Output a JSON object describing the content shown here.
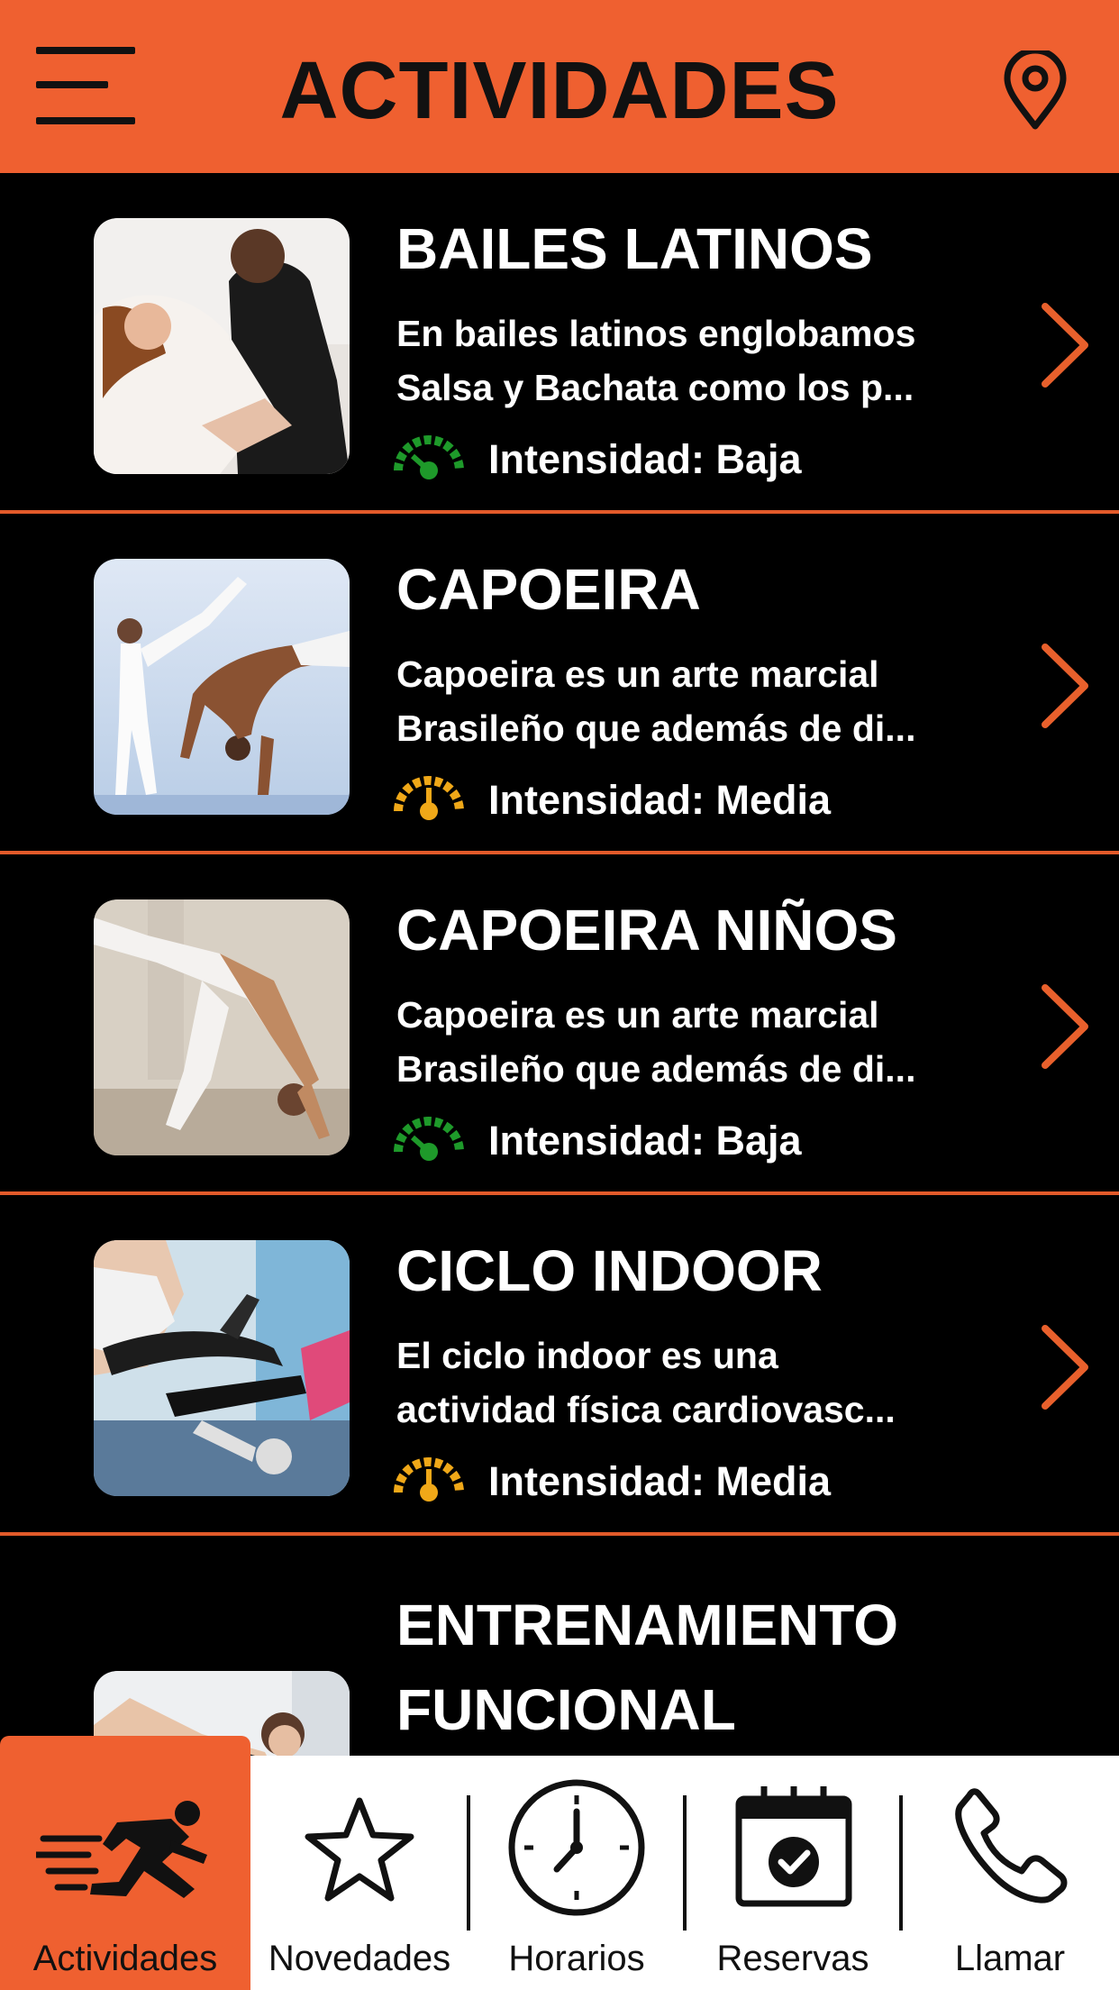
{
  "header": {
    "title": "ACTIVIDADES",
    "menu_icon": "menu-icon",
    "location_icon": "location-pin-icon"
  },
  "colors": {
    "accent": "#ef6030",
    "background": "#000000",
    "intensity_low": "#1e9a2a",
    "intensity_medium": "#f0a818"
  },
  "activities": [
    {
      "title": "BAILES LATINOS",
      "desc_line1": "En bailes latinos englobamos",
      "desc_line2": "Salsa y Bachata como los p...",
      "intensity": "Intensidad: Baja",
      "level": "low"
    },
    {
      "title": "CAPOEIRA",
      "desc_line1": "Capoeira es un arte marcial",
      "desc_line2": "Brasileño que además de di...",
      "intensity": "Intensidad: Media",
      "level": "medium"
    },
    {
      "title": "CAPOEIRA NIÑOS",
      "desc_line1": "Capoeira es un arte marcial",
      "desc_line2": "Brasileño que además de di...",
      "intensity": "Intensidad: Baja",
      "level": "low"
    },
    {
      "title": "CICLO INDOOR",
      "desc_line1": "El ciclo indoor es una",
      "desc_line2": "actividad física cardiovasc...",
      "intensity": "Intensidad: Media",
      "level": "medium"
    },
    {
      "title_line1": "ENTRENAMIENTO",
      "title_line2": "FUNCIONAL"
    }
  ],
  "tabs": [
    {
      "label": "Actividades",
      "icon": "running-man-icon",
      "active": true
    },
    {
      "label": "Novedades",
      "icon": "star-icon"
    },
    {
      "label": "Horarios",
      "icon": "clock-icon"
    },
    {
      "label": "Reservas",
      "icon": "calendar-check-icon"
    },
    {
      "label": "Llamar",
      "icon": "phone-icon"
    }
  ]
}
